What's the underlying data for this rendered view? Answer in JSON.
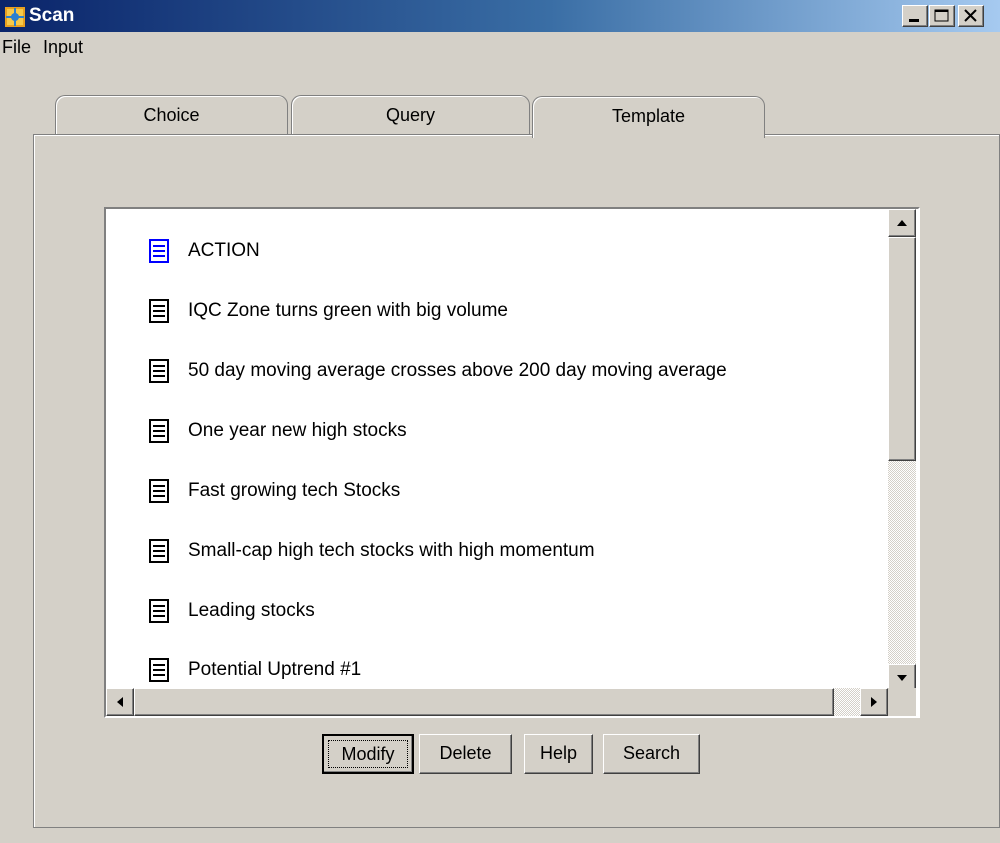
{
  "window": {
    "title": "Scan"
  },
  "menu": [
    "File",
    "Input"
  ],
  "tabs": [
    "Choice",
    "Query",
    "Template"
  ],
  "active_tab": "Template",
  "templates": [
    "ACTION",
    "IQC Zone turns green with big volume",
    "50 day moving average crosses above 200 day moving average",
    "One year new high stocks",
    "Fast growing tech Stocks",
    "Small-cap high tech stocks with high momentum",
    "Leading stocks",
    "Potential Uptrend #1"
  ],
  "selected_template": "ACTION",
  "buttons": {
    "modify": "Modify",
    "delete": "Delete",
    "help": "Help",
    "search": "Search"
  },
  "icons": {
    "app": "scan-app-icon",
    "minimize": "minimize-icon",
    "maximize": "maximize-icon",
    "close": "close-icon",
    "list_item": "document-icon"
  }
}
